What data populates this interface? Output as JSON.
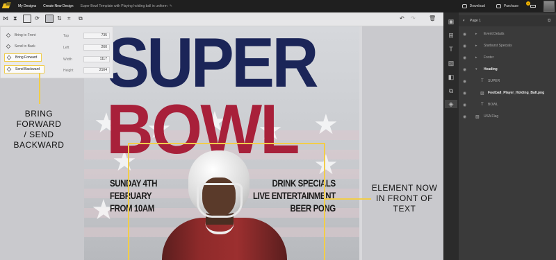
{
  "topbar": {
    "my_designs": "My Designs",
    "create_new": "Create New Design",
    "doc_title": "Super Bowl Template with Playing holding ball in uniform",
    "download": "Download",
    "purchase": "Purchase",
    "cart_count": "1"
  },
  "arrange_panel": {
    "bring_to_front": "Bring to Front",
    "send_to_back": "Send to Back",
    "bring_forward": "Bring Forward",
    "send_backward": "Send Backward",
    "top_label": "Top",
    "top_value": "735",
    "left_label": "Left",
    "left_value": "260",
    "width_label": "Width",
    "width_value": "1117",
    "height_label": "Height",
    "height_value": "2164"
  },
  "poster": {
    "line1": "SUPER",
    "line2": "BOWL",
    "left_info": [
      "SUNDAY 4TH",
      "FEBRUARY",
      "FROM 10AM"
    ],
    "right_info": [
      "DRINK SPECIALS",
      "LIVE ENTERTAINMENT",
      "BEER PONG"
    ]
  },
  "annotations": {
    "left": [
      "BRING",
      "FORWARD",
      "/ SEND",
      "BACKWARD"
    ],
    "right": [
      "ELEMENT NOW",
      "IN FRONT OF",
      "TEXT"
    ]
  },
  "layers": {
    "page": "Page 1",
    "items": [
      {
        "label": "Event Details",
        "bright": false
      },
      {
        "label": "Starburst Specials",
        "bright": false
      },
      {
        "label": "Footer",
        "bright": false
      },
      {
        "label": "Heading",
        "bright": true
      },
      {
        "label": "SUPER",
        "bright": false
      },
      {
        "label": "Football_Player_Holding_Ball.png",
        "bright": true
      },
      {
        "label": "BOWL",
        "bright": false
      },
      {
        "label": "USA Flag",
        "bright": false
      }
    ]
  },
  "colors": {
    "accent_yellow": "#f1cd4a",
    "super_navy": "#1b2558",
    "bowl_red": "#a8203a",
    "topbar": "#1f1f1f",
    "layers_bg": "#3a3a3a"
  },
  "icons": {
    "toolbar": [
      "align-horizontal-icon",
      "align-vertical-icon",
      "frame-icon",
      "rotate-icon",
      "arrange-icon",
      "flip-icon",
      "crop-icon",
      "undo-icon",
      "redo-icon",
      "delete-icon"
    ],
    "strip": [
      "template-icon",
      "layout-icon",
      "text-icon",
      "image-icon",
      "shapes-icon",
      "elements-icon",
      "layers-icon"
    ]
  }
}
